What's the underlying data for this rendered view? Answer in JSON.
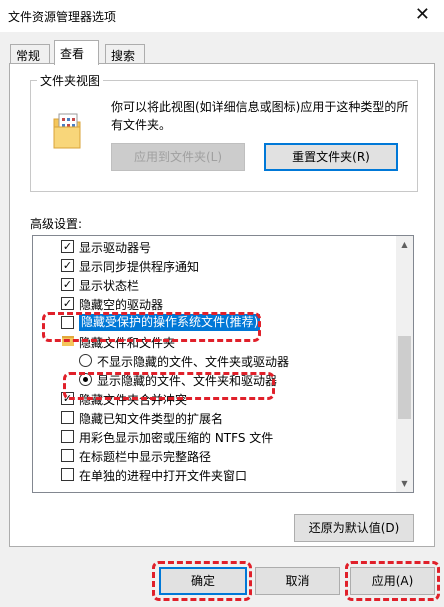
{
  "window": {
    "title": "文件资源管理器选项",
    "close_glyph": "✕"
  },
  "tabs": [
    {
      "label": "常规"
    },
    {
      "label": "查看"
    },
    {
      "label": "搜索"
    }
  ],
  "folder_view": {
    "label": "文件夹视图",
    "description": "你可以将此视图(如详细信息或图标)应用于这种类型的所有文件夹。",
    "apply_button": "应用到文件夹(L)",
    "reset_button": "重置文件夹(R)"
  },
  "advanced": {
    "label": "高级设置:",
    "items": [
      {
        "kind": "checkbox",
        "checked": true,
        "label": "显示驱动器号"
      },
      {
        "kind": "checkbox",
        "checked": true,
        "label": "显示同步提供程序通知"
      },
      {
        "kind": "checkbox",
        "checked": true,
        "label": "显示状态栏"
      },
      {
        "kind": "checkbox",
        "checked": true,
        "label": "隐藏空的驱动器"
      },
      {
        "kind": "checkbox",
        "checked": false,
        "label": "隐藏受保护的操作系统文件(推荐)",
        "selected": true
      },
      {
        "kind": "folder",
        "label": "隐藏文件和文件夹"
      },
      {
        "kind": "radio",
        "checked": false,
        "label": "不显示隐藏的文件、文件夹或驱动器"
      },
      {
        "kind": "radio",
        "checked": true,
        "label": "显示隐藏的文件、文件夹和驱动器"
      },
      {
        "kind": "checkbox",
        "checked": true,
        "label": "隐藏文件夹合并冲突"
      },
      {
        "kind": "checkbox",
        "checked": false,
        "label": "隐藏已知文件类型的扩展名"
      },
      {
        "kind": "checkbox",
        "checked": false,
        "label": "用彩色显示加密或压缩的 NTFS 文件"
      },
      {
        "kind": "checkbox",
        "checked": false,
        "label": "在标题栏中显示完整路径"
      },
      {
        "kind": "checkbox",
        "checked": false,
        "label": "在单独的进程中打开文件夹窗口"
      }
    ],
    "restore_button": "还原为默认值(D)"
  },
  "footer": {
    "ok_button": "确定",
    "cancel_button": "取消",
    "apply_button": "应用(A)"
  },
  "colors": {
    "accent": "#0078d7",
    "highlight_box": "#e0202a"
  }
}
